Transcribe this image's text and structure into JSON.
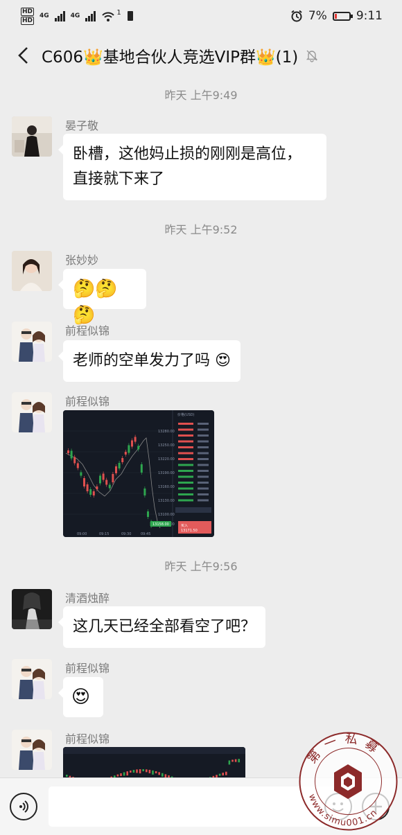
{
  "status_bar": {
    "hd1": "HD",
    "hd2": "HD",
    "net1": "4G",
    "net2": "4G",
    "wifi_num": "1",
    "battery": "7%",
    "time": "9:11"
  },
  "header": {
    "title": "C606👑基地合伙人竞选VIP群👑(1)"
  },
  "chat": {
    "timestamps": [
      "昨天 上午9:49",
      "昨天 上午9:52",
      "昨天 上午9:56"
    ],
    "messages": [
      {
        "name": "晏子敬",
        "text": "卧槽，这他妈止损的刚刚是高位，",
        "text2": "直接就下来了"
      },
      {
        "name": "张妙妙",
        "emoji": "🤔🤔🤔"
      },
      {
        "name": "前程似锦",
        "text": "老师的空单发力了吗"
      },
      {
        "name": "前程似锦",
        "image": "chart-screenshot"
      },
      {
        "name": "清酒烛醉",
        "text": "这几天已经全部看空了吧？"
      },
      {
        "name": "前程似锦",
        "emoji": "😍"
      },
      {
        "name": "前程似锦",
        "image": "chart-screenshot"
      }
    ]
  },
  "chart_image": {
    "price_labels": [
      "13280.00",
      "13250.00",
      "13220.00",
      "13190.00",
      "13160.00",
      "13130.00",
      "13100.00",
      "13070.00"
    ],
    "order_book_header": "价格(USD)",
    "buy_label": "买入",
    "buy_price": "13171.50",
    "last_price": "13158.00",
    "x_labels": [
      "09:00",
      "09:15",
      "09:30",
      "09:45"
    ]
  },
  "watermark": {
    "text_top": "第一私募",
    "text_bottom": "www.simu001.cn"
  },
  "icons": {
    "back": "chevron-left-icon",
    "mute": "bell-off-icon",
    "voice": "voice-icon",
    "emoji": "emoji-icon",
    "plus": "plus-icon"
  }
}
